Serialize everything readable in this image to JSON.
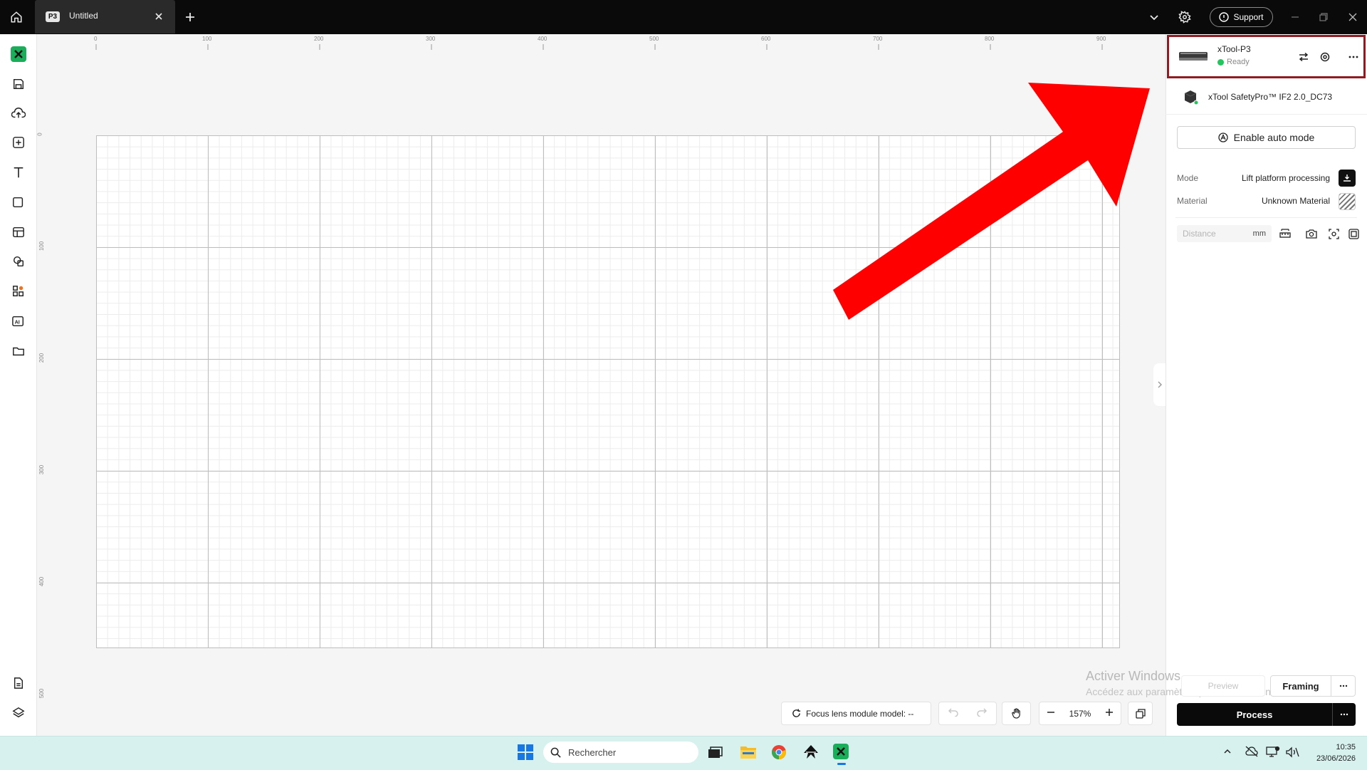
{
  "titlebar": {
    "tab_badge": "P3",
    "tab_title": "Untitled",
    "support_label": "Support"
  },
  "ruler": {
    "top_labels": [
      "0",
      "100",
      "200",
      "300",
      "400",
      "500",
      "600",
      "700",
      "800",
      "900"
    ],
    "left_labels": [
      "0",
      "100",
      "200",
      "300",
      "400",
      "500"
    ]
  },
  "device": {
    "name": "xTool-P3",
    "status": "Ready",
    "status_color": "#22c55e",
    "accessory": "xTool SafetyPro™ IF2 2.0_DC73"
  },
  "panel": {
    "auto_mode_label": "Enable auto mode",
    "mode_label": "Mode",
    "mode_value": "Lift platform processing",
    "material_label": "Material",
    "material_value": "Unknown Material",
    "distance_placeholder": "Distance",
    "distance_unit": "mm"
  },
  "actions": {
    "preview_label": "Preview",
    "framing_label": "Framing",
    "process_label": "Process"
  },
  "bottombar": {
    "focus_label": "Focus lens module model: --",
    "zoom": "157%"
  },
  "watermark": {
    "line1": "Activer Windows",
    "line2": "Accédez aux paramètres pour activer Windows."
  },
  "taskbar": {
    "search_placeholder": "Rechercher",
    "time": "10:35",
    "date": "23/06/2026"
  },
  "colors": {
    "accent": "#1aae5a",
    "highlight_border": "#8f1c23",
    "annotation_arrow": "#ff0000"
  },
  "icons": [
    "home-icon",
    "close-icon",
    "plus-icon",
    "chevron-down-icon",
    "gear-icon",
    "minimize-icon",
    "restore-icon",
    "swap-icon",
    "target-icon",
    "more-icon",
    "camera-icon",
    "hand-icon",
    "undo-icon",
    "redo-icon",
    "zoom-out-icon",
    "zoom-in-icon",
    "copy-icon",
    "search-icon",
    "windows-start-icon"
  ]
}
